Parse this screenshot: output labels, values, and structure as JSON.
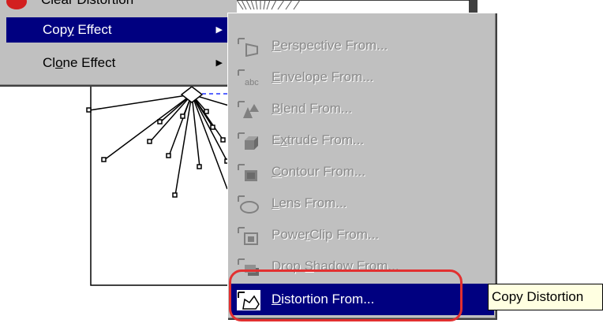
{
  "top_menu_item": {
    "label": "Clear Distortion"
  },
  "parent_menu": {
    "items": [
      {
        "label_pre": "Cop",
        "label_u": "y",
        "label_post": " Effect",
        "selected": true
      },
      {
        "label_pre": "Cl",
        "label_u": "o",
        "label_post": "ne Effect",
        "selected": false
      }
    ]
  },
  "submenu": {
    "items": [
      {
        "u": "P",
        "rest": "erspective From...",
        "icon": "perspective-icon"
      },
      {
        "u": "E",
        "rest": "nvelope From...",
        "icon": "envelope-icon"
      },
      {
        "u": "B",
        "rest": "lend From...",
        "icon": "blend-icon"
      },
      {
        "pre": "E",
        "u": "x",
        "rest": "trude From...",
        "icon": "extrude-icon"
      },
      {
        "u": "C",
        "rest": "ontour From...",
        "icon": "contour-icon"
      },
      {
        "u": "L",
        "rest": "ens From...",
        "icon": "lens-icon"
      },
      {
        "pre": "Powe",
        "u": "r",
        "rest": "Clip From...",
        "icon": "powerclip-icon"
      },
      {
        "pre": "Drop ",
        "u": "S",
        "rest": "hadow From...",
        "icon": "drop-shadow-icon"
      },
      {
        "u": "D",
        "rest": "istortion From...",
        "icon": "distortion-icon"
      }
    ]
  },
  "tooltip": {
    "text": "Copy Distortion"
  },
  "colors": {
    "menu_bg": "#c0c0c0",
    "selection": "#000080",
    "disabled_text": "#8a8a8a",
    "highlight_ring": "#e23030",
    "tooltip_bg": "#ffffe1"
  }
}
